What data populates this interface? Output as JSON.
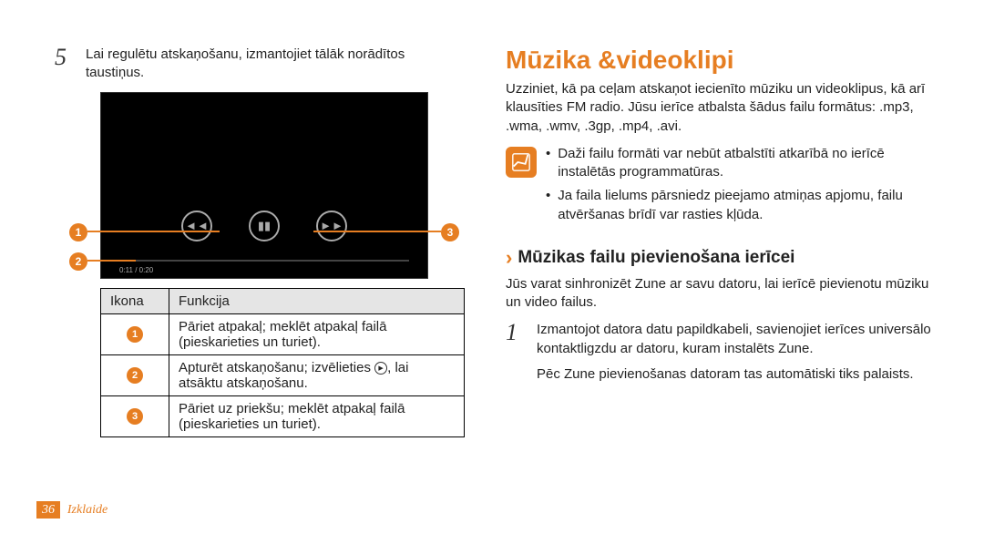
{
  "left": {
    "step5_num": "5",
    "step5_text": "Lai regulētu atskaņošanu, izmantojiet tālāk norādītos taustiņus.",
    "player_time": "0:11  / 0:20",
    "table": {
      "head_icon": "Ikona",
      "head_fn": "Funkcija",
      "rows": [
        {
          "num": "1",
          "text_a": "Pāriet atpakaļ; meklēt atpakaļ failā (pieskarieties un turiet).",
          "has_play": false
        },
        {
          "num": "2",
          "text_a": "Apturēt atskaņošanu; izvēlieties ",
          "text_b": ", lai atsāktu atskaņošanu.",
          "has_play": true
        },
        {
          "num": "3",
          "text_a": "Pāriet uz priekšu; meklēt atpakaļ failā (pieskarieties un turiet).",
          "has_play": false
        }
      ]
    }
  },
  "right": {
    "title": "Mūzika &videoklipi",
    "intro": "Uzziniet, kā pa ceļam atskaņot iecienīto mūziku un videoklipus, kā arī klausīties FM radio. Jūsu ierīce atbalsta šādus failu formātus: .mp3, .wma, .wmv, .3gp, .mp4, .avi.",
    "notes": [
      "Daži failu formāti var nebūt atbalstīti atkarībā no ierīcē instalētās programmatūras.",
      "Ja faila lielums pārsniedz pieejamo atmiņas apjomu, failu atvēršanas brīdī var rasties kļūda."
    ],
    "h2": "Mūzikas failu pievienošana ierīcei",
    "p2": "Jūs varat sinhronizēt Zune ar savu datoru, lai ierīcē pievienotu mūziku un video failus.",
    "step1_num": "1",
    "step1_text": "Izmantojot datora datu papildkabeli, savienojiet ierīces universālo kontaktligzdu ar datoru, kuram instalēts Zune.",
    "step1_after": "Pēc Zune pievienošanas datoram tas automātiski tiks palaists."
  },
  "footer": {
    "page": "36",
    "section": "Izklaide"
  }
}
